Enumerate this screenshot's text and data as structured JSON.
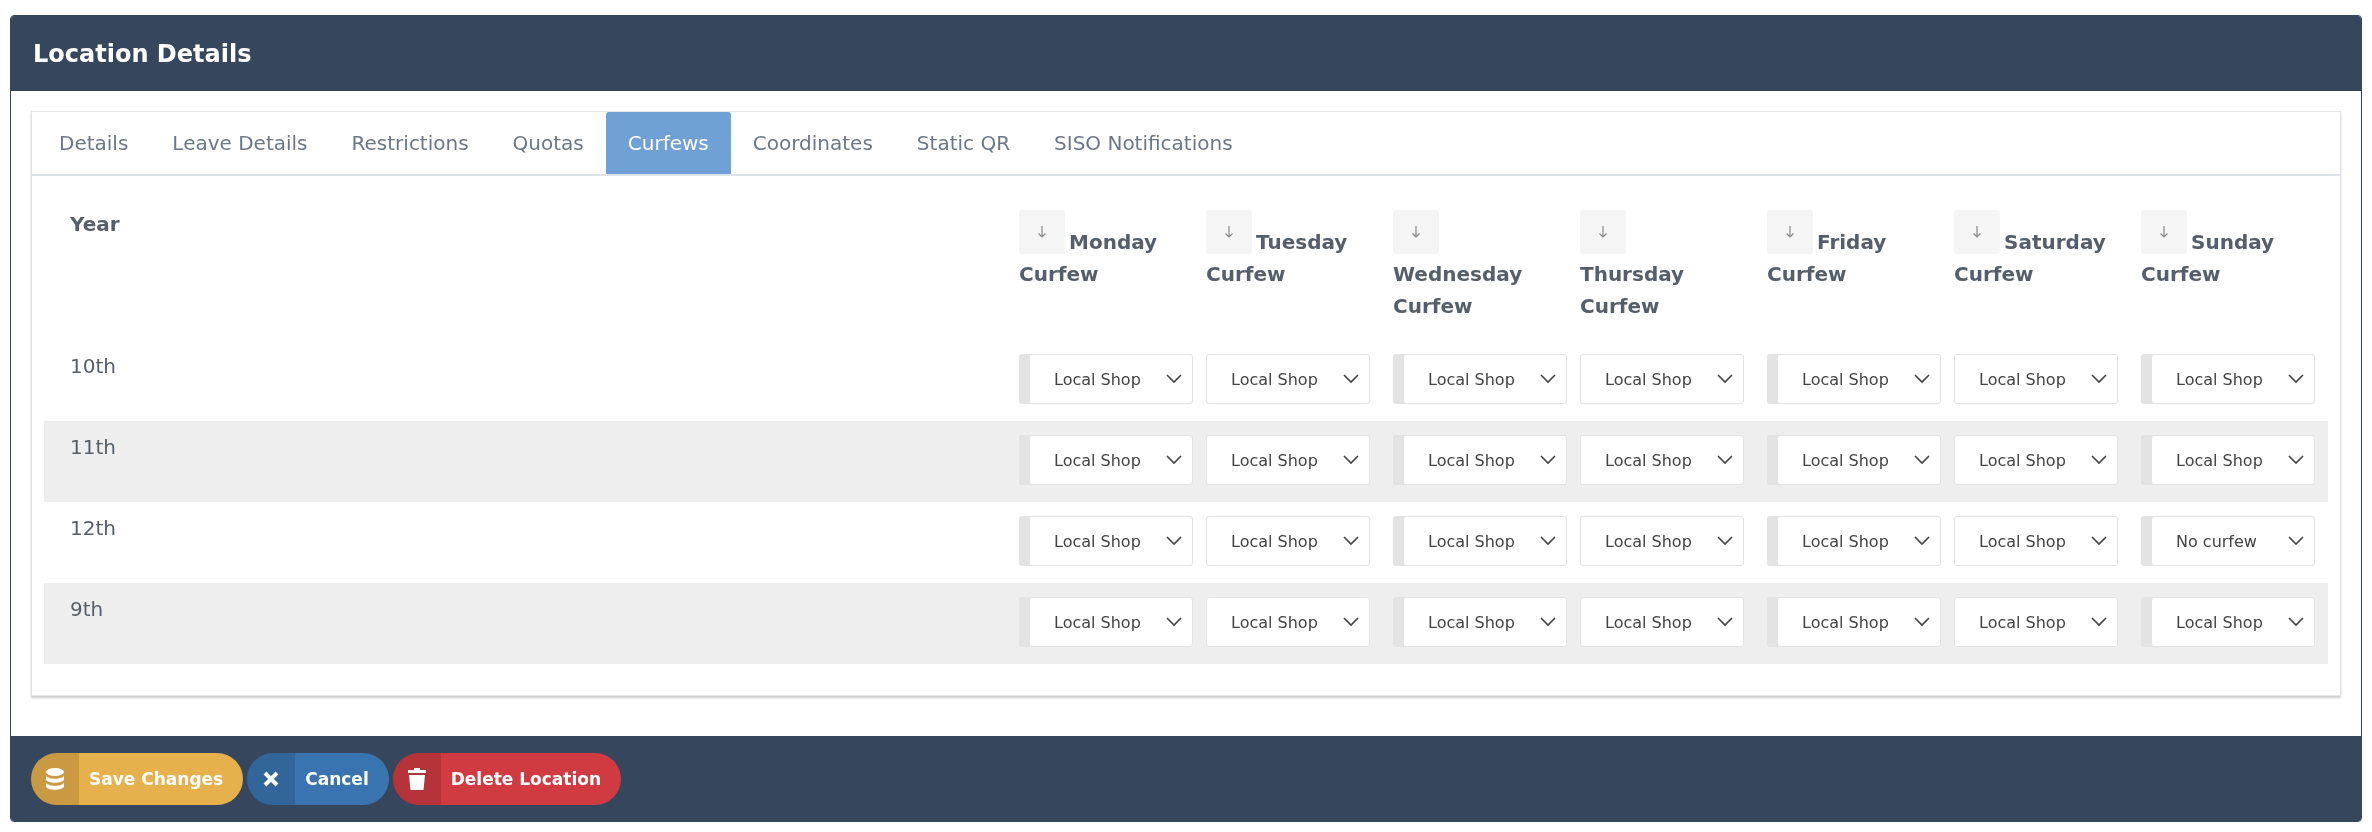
{
  "window": {
    "title": "Location Details"
  },
  "tabs": [
    {
      "label": "Details",
      "selected": false
    },
    {
      "label": "Leave Details",
      "selected": false
    },
    {
      "label": "Restrictions",
      "selected": false
    },
    {
      "label": "Quotas",
      "selected": false
    },
    {
      "label": "Curfews",
      "selected": true
    },
    {
      "label": "Coordinates",
      "selected": false
    },
    {
      "label": "Static QR",
      "selected": false
    },
    {
      "label": "SISO Notifications",
      "selected": false
    }
  ],
  "table": {
    "year_heading": "Year",
    "columns": [
      {
        "day": "Monday",
        "suffix": "Curfew"
      },
      {
        "day": "Tuesday",
        "suffix": "Curfew"
      },
      {
        "day": "Wednesday",
        "suffix": "Curfew"
      },
      {
        "day": "Thursday",
        "suffix": "Curfew"
      },
      {
        "day": "Friday",
        "suffix": "Curfew"
      },
      {
        "day": "Saturday",
        "suffix": "Curfew"
      },
      {
        "day": "Sunday",
        "suffix": "Curfew"
      }
    ],
    "rows": [
      {
        "year": "10th",
        "values": [
          "Local Shop",
          "Local Shop",
          "Local Shop",
          "Local Shop",
          "Local Shop",
          "Local Shop",
          "Local Shop"
        ]
      },
      {
        "year": "11th",
        "values": [
          "Local Shop",
          "Local Shop",
          "Local Shop",
          "Local Shop",
          "Local Shop",
          "Local Shop",
          "Local Shop"
        ]
      },
      {
        "year": "12th",
        "values": [
          "Local Shop",
          "Local Shop",
          "Local Shop",
          "Local Shop",
          "Local Shop",
          "Local Shop",
          "No curfew"
        ]
      },
      {
        "year": "9th",
        "values": [
          "Local Shop",
          "Local Shop",
          "Local Shop",
          "Local Shop",
          "Local Shop",
          "Local Shop",
          "Local Shop"
        ]
      }
    ]
  },
  "buttons": [
    {
      "kind": "save",
      "label": "Save Changes"
    },
    {
      "kind": "cancel",
      "label": "Cancel"
    },
    {
      "kind": "delete",
      "label": "Delete Location"
    }
  ]
}
